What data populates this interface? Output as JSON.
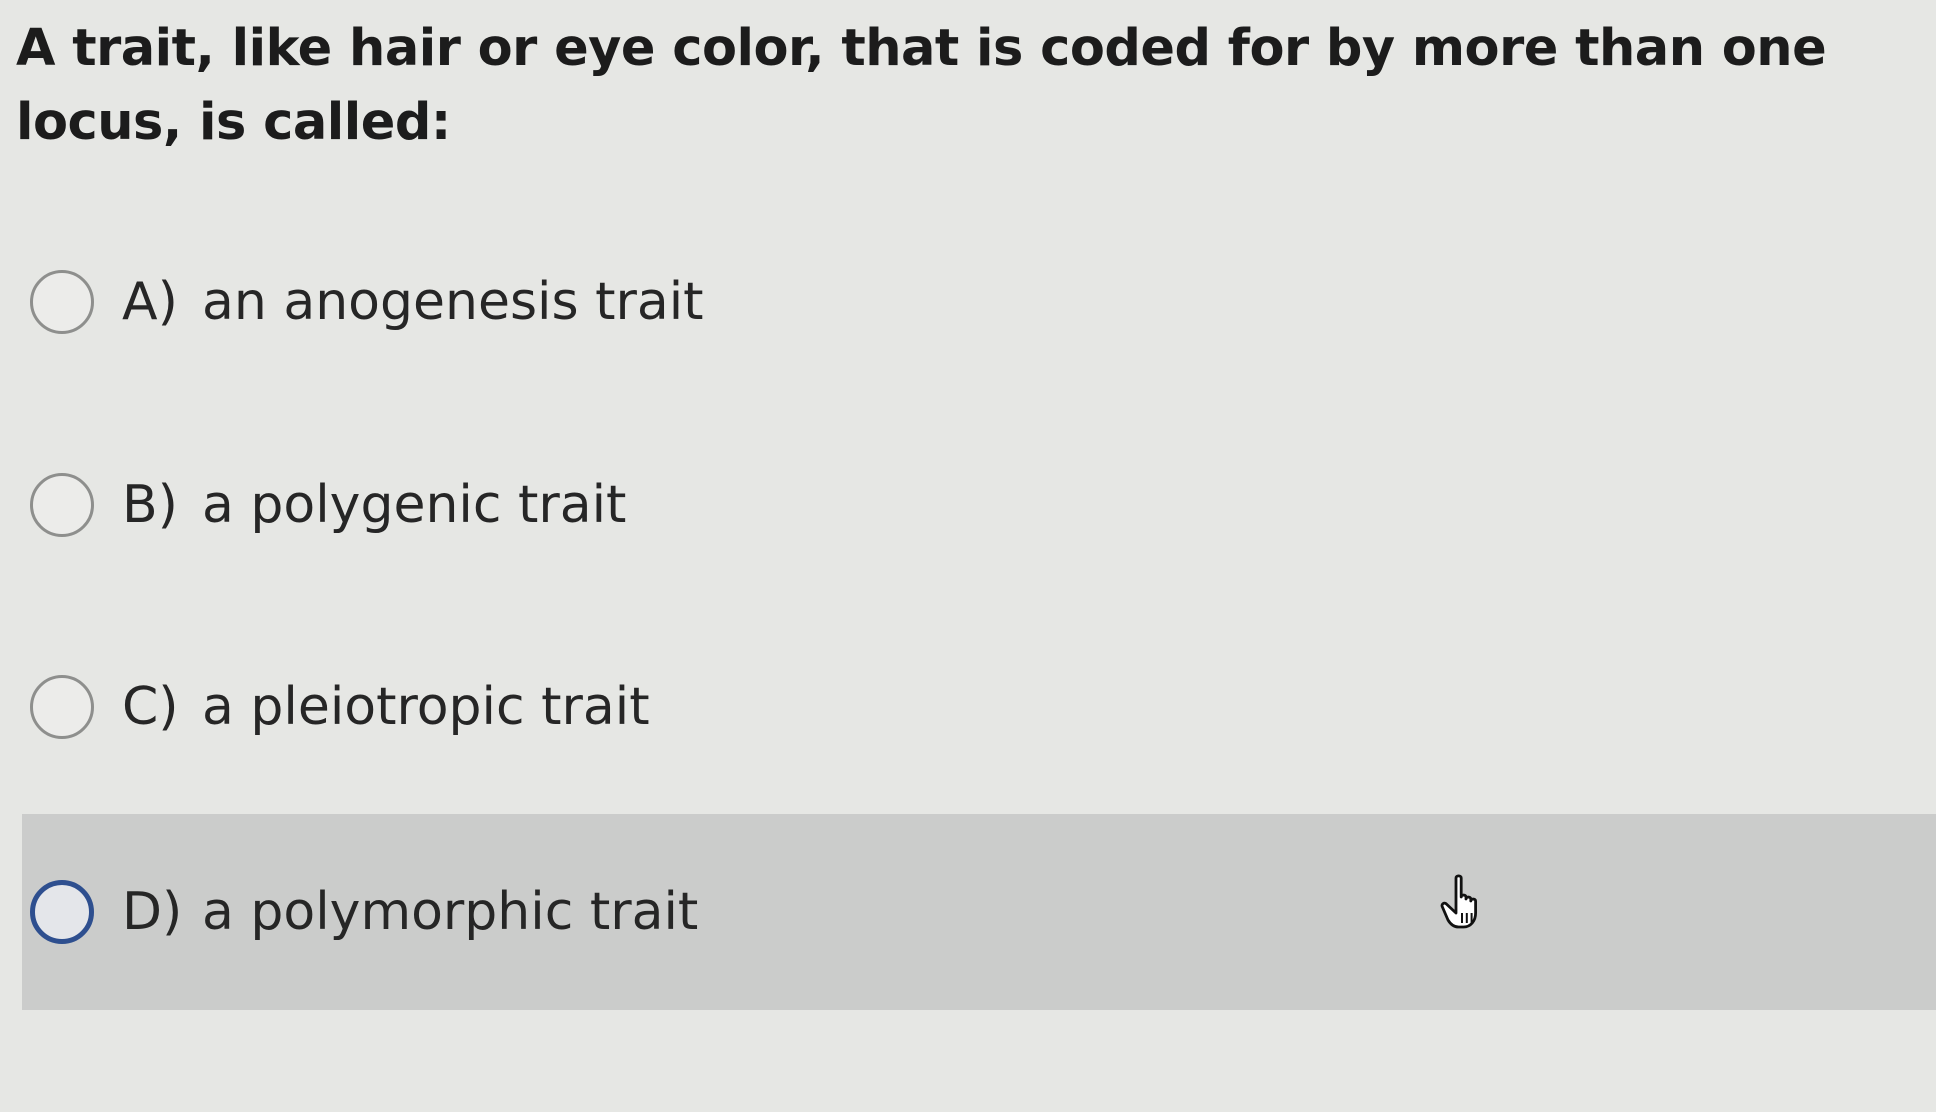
{
  "question": {
    "text": "A trait, like hair or eye color, that is coded for by more than one locus, is called:"
  },
  "options": [
    {
      "letter": "A)",
      "text": "an anogenesis trait",
      "selected": false,
      "hovered": false
    },
    {
      "letter": "B)",
      "text": "a polygenic trait",
      "selected": false,
      "hovered": false
    },
    {
      "letter": "C)",
      "text": "a pleiotropic trait",
      "selected": false,
      "hovered": false
    },
    {
      "letter": "D)",
      "text": "a polymorphic trait",
      "selected": false,
      "hovered": true
    }
  ],
  "colors": {
    "page_background": "#e6e7e4",
    "hover_background": "#cbcccb",
    "radio_border": "#8e8f8d",
    "radio_focus_border": "#2e4f8f",
    "text": "#1f1f1f"
  },
  "icons": {
    "cursor": "hand-pointer-icon"
  }
}
